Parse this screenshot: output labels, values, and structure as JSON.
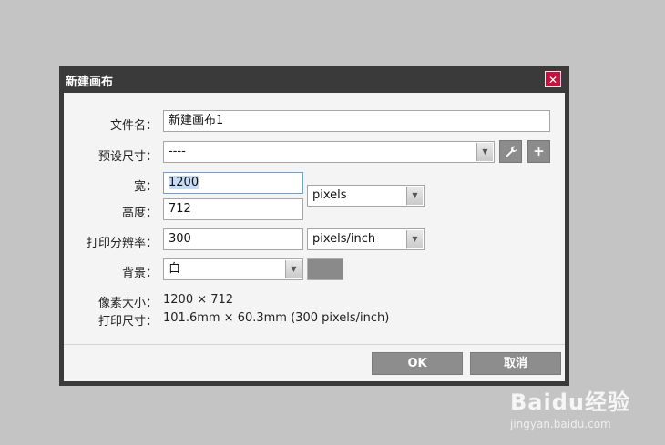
{
  "dialog": {
    "title": "新建画布",
    "close_symbol": "✕"
  },
  "form": {
    "filename": {
      "label": "文件名：",
      "value": "新建画布1"
    },
    "preset": {
      "label": "预设尺寸：",
      "value": "----"
    },
    "width": {
      "label": "宽：",
      "value": "1200"
    },
    "height": {
      "label": "高度：",
      "value": "712"
    },
    "size_unit": {
      "value": "pixels"
    },
    "resolution": {
      "label": "打印分辨率：",
      "value": "300"
    },
    "resolution_unit": {
      "value": "pixels/inch"
    },
    "background": {
      "label": "背景：",
      "value": "白",
      "swatch_color": "#8a8a8a"
    }
  },
  "info": {
    "pixel_size_label": "像素大小：",
    "pixel_size_value": "1200 × 712",
    "print_size_label": "打印尺寸：",
    "print_size_value": "101.6mm × 60.3mm (300 pixels/inch)"
  },
  "buttons": {
    "ok": "OK",
    "cancel": "取消"
  },
  "icons": {
    "wrench": "wrench-icon",
    "plus": "plus-icon",
    "dropdown": "chevron-down-icon"
  },
  "watermark": {
    "logo": "Baidu经验",
    "url": "jingyan.baidu.com"
  }
}
